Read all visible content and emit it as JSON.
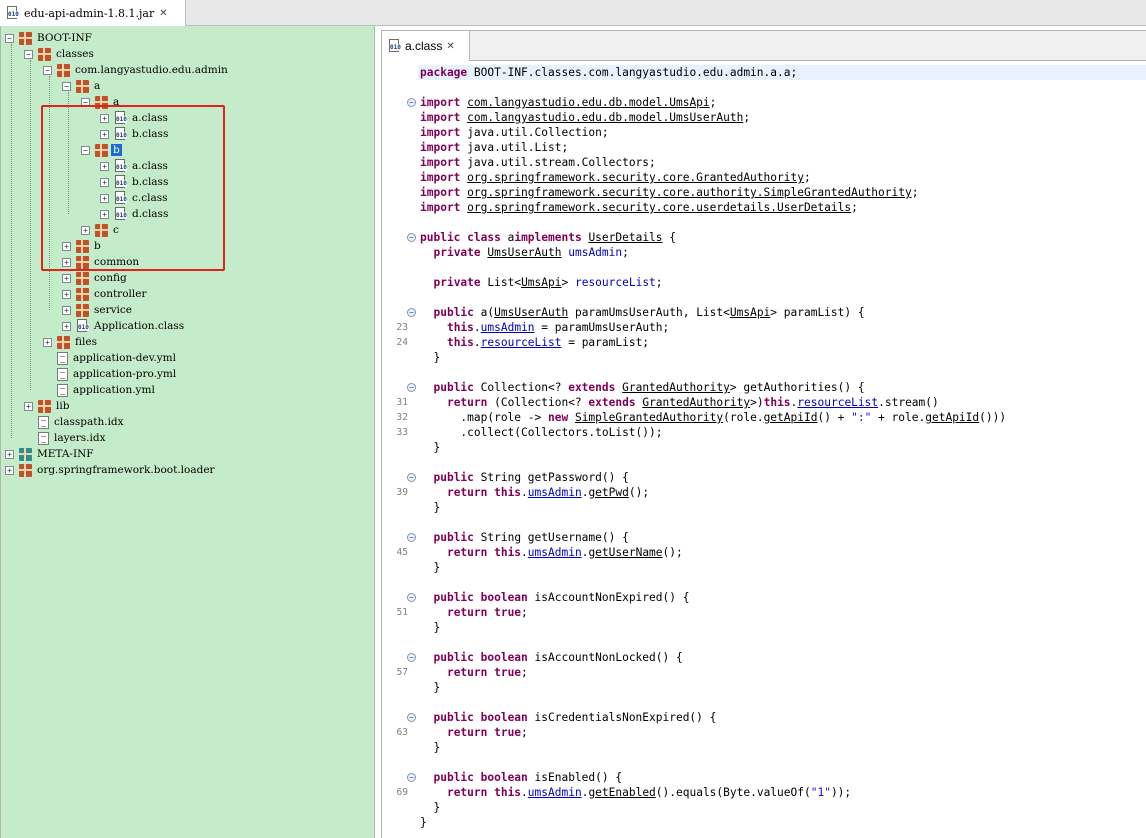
{
  "window": {
    "tab_title": "edu-api-admin-1.8.1.jar"
  },
  "tree": {
    "nodes": [
      {
        "label": "BOOT-INF",
        "icon": "package-icon",
        "expander": "minus"
      },
      {
        "label": "classes",
        "icon": "package-icon",
        "expander": "minus"
      },
      {
        "label": "com.langyastudio.edu.admin",
        "icon": "package-icon",
        "expander": "minus"
      },
      {
        "label": "a",
        "icon": "package-icon",
        "expander": "minus"
      },
      {
        "label": "a",
        "icon": "package-icon",
        "expander": "minus"
      },
      {
        "label": "a.class",
        "icon": "class-file-icon",
        "expander": "plus"
      },
      {
        "label": "b.class",
        "icon": "class-file-icon",
        "expander": "plus"
      },
      {
        "label": "b",
        "icon": "package-icon",
        "expander": "minus",
        "selected": true
      },
      {
        "label": "a.class",
        "icon": "class-file-icon",
        "expander": "plus"
      },
      {
        "label": "b.class",
        "icon": "class-file-icon",
        "expander": "plus"
      },
      {
        "label": "c.class",
        "icon": "class-file-icon",
        "expander": "plus"
      },
      {
        "label": "d.class",
        "icon": "class-file-icon",
        "expander": "plus"
      },
      {
        "label": "c",
        "icon": "package-icon",
        "expander": "plus"
      },
      {
        "label": "b",
        "icon": "package-icon",
        "expander": "plus"
      },
      {
        "label": "common",
        "icon": "package-icon",
        "expander": "plus"
      },
      {
        "label": "config",
        "icon": "package-icon",
        "expander": "plus"
      },
      {
        "label": "controller",
        "icon": "package-icon",
        "expander": "plus"
      },
      {
        "label": "service",
        "icon": "package-icon",
        "expander": "plus"
      },
      {
        "label": "Application.class",
        "icon": "class-file-icon",
        "expander": "plus"
      },
      {
        "label": "files",
        "icon": "package-icon",
        "expander": "plus"
      },
      {
        "label": "application-dev.yml",
        "icon": "text-file-icon",
        "expander": "none"
      },
      {
        "label": "application-pro.yml",
        "icon": "text-file-icon",
        "expander": "none"
      },
      {
        "label": "application.yml",
        "icon": "text-file-icon",
        "expander": "none"
      },
      {
        "label": "lib",
        "icon": "package-icon",
        "expander": "plus"
      },
      {
        "label": "classpath.idx",
        "icon": "text-file-icon",
        "expander": "none"
      },
      {
        "label": "layers.idx",
        "icon": "text-file-icon",
        "expander": "none"
      },
      {
        "label": "META-INF",
        "icon": "meta-package-icon",
        "expander": "plus"
      },
      {
        "label": "org.springframework.boot.loader",
        "icon": "package-icon",
        "expander": "plus"
      }
    ]
  },
  "editor": {
    "tab_label": "a.class",
    "lines": [
      {
        "num": "",
        "fold": "",
        "hl": true,
        "segs": [
          [
            "kw",
            "package"
          ],
          [
            "",
            "BOOT-INF.classes.com.langyastudio.edu.admin.a.a;"
          ]
        ]
      },
      {
        "num": "",
        "fold": "",
        "segs": []
      },
      {
        "num": "",
        "fold": "−",
        "segs": [
          [
            "kw",
            "import"
          ],
          [
            "u",
            "com.langyastudio.edu.db.model.UmsApi"
          ],
          [
            "",
            ";"
          ]
        ]
      },
      {
        "num": "",
        "fold": "",
        "segs": [
          [
            "kw",
            "import"
          ],
          [
            "u",
            "com.langyastudio.edu.db.model.UmsUserAuth"
          ],
          [
            "",
            ";"
          ]
        ]
      },
      {
        "num": "",
        "fold": "",
        "segs": [
          [
            "kw",
            "import"
          ],
          [
            "",
            "java.util.Collection;"
          ]
        ]
      },
      {
        "num": "",
        "fold": "",
        "segs": [
          [
            "kw",
            "import"
          ],
          [
            "",
            "java.util.List;"
          ]
        ]
      },
      {
        "num": "",
        "fold": "",
        "segs": [
          [
            "kw",
            "import"
          ],
          [
            "",
            "java.util.stream.Collectors;"
          ]
        ]
      },
      {
        "num": "",
        "fold": "",
        "segs": [
          [
            "kw",
            "import"
          ],
          [
            "u",
            "org.springframework.security.core.GrantedAuthority"
          ],
          [
            "",
            ";"
          ]
        ]
      },
      {
        "num": "",
        "fold": "",
        "segs": [
          [
            "kw",
            "import"
          ],
          [
            "u",
            "org.springframework.security.core.authority.SimpleGrantedAuthority"
          ],
          [
            "",
            ";"
          ]
        ]
      },
      {
        "num": "",
        "fold": "",
        "segs": [
          [
            "kw",
            "import"
          ],
          [
            "u",
            "org.springframework.security.core.userdetails.UserDetails"
          ],
          [
            "",
            ";"
          ]
        ]
      },
      {
        "num": "",
        "fold": "",
        "segs": []
      },
      {
        "num": "",
        "fold": "−",
        "segs": [
          [
            "kw",
            "public class"
          ],
          [
            "",
            "a"
          ],
          [
            "kw",
            "implements"
          ],
          [
            "u",
            "UserDetails"
          ],
          [
            "",
            " {"
          ]
        ]
      },
      {
        "num": "",
        "fold": "",
        "segs": [
          [
            "",
            "  "
          ],
          [
            "kw",
            "private"
          ],
          [
            "u",
            "UmsUserAuth"
          ],
          [
            "",
            " "
          ],
          [
            "fld",
            "umsAdmin"
          ],
          [
            "",
            ";"
          ]
        ]
      },
      {
        "num": "",
        "fold": "",
        "segs": []
      },
      {
        "num": "",
        "fold": "",
        "segs": [
          [
            "",
            "  "
          ],
          [
            "kw",
            "private"
          ],
          [
            "",
            " List<"
          ],
          [
            "u",
            "UmsApi"
          ],
          [
            "",
            "> "
          ],
          [
            "fld",
            "resourceList"
          ],
          [
            "",
            ";"
          ]
        ]
      },
      {
        "num": "",
        "fold": "",
        "segs": []
      },
      {
        "num": "",
        "fold": "−",
        "segs": [
          [
            "",
            "  "
          ],
          [
            "kw",
            "public"
          ],
          [
            "",
            " a("
          ],
          [
            "u",
            "UmsUserAuth"
          ],
          [
            "",
            " paramUmsUserAuth, List<"
          ],
          [
            "u",
            "UmsApi"
          ],
          [
            "",
            "> paramList) {"
          ]
        ]
      },
      {
        "num": "23",
        "fold": "",
        "segs": [
          [
            "",
            "    "
          ],
          [
            "kw",
            "this"
          ],
          [
            "",
            "."
          ],
          [
            "fld u",
            "umsAdmin"
          ],
          [
            "",
            " = paramUmsUserAuth;"
          ]
        ]
      },
      {
        "num": "24",
        "fold": "",
        "segs": [
          [
            "",
            "    "
          ],
          [
            "kw",
            "this"
          ],
          [
            "",
            "."
          ],
          [
            "fld u",
            "resourceList"
          ],
          [
            "",
            " = paramList;"
          ]
        ]
      },
      {
        "num": "",
        "fold": "",
        "segs": [
          [
            "",
            "  }"
          ]
        ]
      },
      {
        "num": "",
        "fold": "",
        "segs": []
      },
      {
        "num": "",
        "fold": "−",
        "segs": [
          [
            "",
            "  "
          ],
          [
            "kw",
            "public"
          ],
          [
            "",
            " Collection<? "
          ],
          [
            "kw",
            "extends"
          ],
          [
            "u",
            "GrantedAuthority"
          ],
          [
            "",
            "> getAuthorities() {"
          ]
        ]
      },
      {
        "num": "31",
        "fold": "",
        "segs": [
          [
            "",
            "    "
          ],
          [
            "kw",
            "return"
          ],
          [
            "",
            " (Collection<? "
          ],
          [
            "kw",
            "extends"
          ],
          [
            "u",
            "GrantedAuthority"
          ],
          [
            "",
            ">)"
          ],
          [
            "kw",
            "this"
          ],
          [
            "",
            "."
          ],
          [
            "fld u",
            "resourceList"
          ],
          [
            "",
            ".stream()"
          ]
        ]
      },
      {
        "num": "32",
        "fold": "",
        "segs": [
          [
            "",
            "      .map(role -> "
          ],
          [
            "kw",
            "new"
          ],
          [
            "u",
            "SimpleGrantedAuthority"
          ],
          [
            "",
            "(role."
          ],
          [
            "u",
            "getApiId"
          ],
          [
            "",
            "() + "
          ],
          [
            "str",
            "\":\""
          ],
          [
            "",
            " + role."
          ],
          [
            "u",
            "getApiId"
          ],
          [
            "",
            "()))"
          ]
        ]
      },
      {
        "num": "33",
        "fold": "",
        "segs": [
          [
            "",
            "      .collect(Collectors.toList());"
          ]
        ]
      },
      {
        "num": "",
        "fold": "",
        "segs": [
          [
            "",
            "  }"
          ]
        ]
      },
      {
        "num": "",
        "fold": "",
        "segs": []
      },
      {
        "num": "",
        "fold": "−",
        "segs": [
          [
            "",
            "  "
          ],
          [
            "kw",
            "public"
          ],
          [
            "",
            " String getPassword() {"
          ]
        ]
      },
      {
        "num": "39",
        "fold": "",
        "segs": [
          [
            "",
            "    "
          ],
          [
            "kw",
            "return this"
          ],
          [
            "",
            "."
          ],
          [
            "fld u",
            "umsAdmin"
          ],
          [
            "",
            "."
          ],
          [
            "u",
            "getPwd"
          ],
          [
            "",
            "();"
          ]
        ]
      },
      {
        "num": "",
        "fold": "",
        "segs": [
          [
            "",
            "  }"
          ]
        ]
      },
      {
        "num": "",
        "fold": "",
        "segs": []
      },
      {
        "num": "",
        "fold": "−",
        "segs": [
          [
            "",
            "  "
          ],
          [
            "kw",
            "public"
          ],
          [
            "",
            " String getUsername() {"
          ]
        ]
      },
      {
        "num": "45",
        "fold": "",
        "segs": [
          [
            "",
            "    "
          ],
          [
            "kw",
            "return this"
          ],
          [
            "",
            "."
          ],
          [
            "fld u",
            "umsAdmin"
          ],
          [
            "",
            "."
          ],
          [
            "u",
            "getUserName"
          ],
          [
            "",
            "();"
          ]
        ]
      },
      {
        "num": "",
        "fold": "",
        "segs": [
          [
            "",
            "  }"
          ]
        ]
      },
      {
        "num": "",
        "fold": "",
        "segs": []
      },
      {
        "num": "",
        "fold": "−",
        "segs": [
          [
            "",
            "  "
          ],
          [
            "kw",
            "public boolean"
          ],
          [
            "",
            " isAccountNonExpired() {"
          ]
        ]
      },
      {
        "num": "51",
        "fold": "",
        "segs": [
          [
            "",
            "    "
          ],
          [
            "kw",
            "return true"
          ],
          [
            "",
            ";"
          ]
        ]
      },
      {
        "num": "",
        "fold": "",
        "segs": [
          [
            "",
            "  }"
          ]
        ]
      },
      {
        "num": "",
        "fold": "",
        "segs": []
      },
      {
        "num": "",
        "fold": "−",
        "segs": [
          [
            "",
            "  "
          ],
          [
            "kw",
            "public boolean"
          ],
          [
            "",
            " isAccountNonLocked() {"
          ]
        ]
      },
      {
        "num": "57",
        "fold": "",
        "segs": [
          [
            "",
            "    "
          ],
          [
            "kw",
            "return true"
          ],
          [
            "",
            ";"
          ]
        ]
      },
      {
        "num": "",
        "fold": "",
        "segs": [
          [
            "",
            "  }"
          ]
        ]
      },
      {
        "num": "",
        "fold": "",
        "segs": []
      },
      {
        "num": "",
        "fold": "−",
        "segs": [
          [
            "",
            "  "
          ],
          [
            "kw",
            "public boolean"
          ],
          [
            "",
            " isCredentialsNonExpired() {"
          ]
        ]
      },
      {
        "num": "63",
        "fold": "",
        "segs": [
          [
            "",
            "    "
          ],
          [
            "kw",
            "return true"
          ],
          [
            "",
            ";"
          ]
        ]
      },
      {
        "num": "",
        "fold": "",
        "segs": [
          [
            "",
            "  }"
          ]
        ]
      },
      {
        "num": "",
        "fold": "",
        "segs": []
      },
      {
        "num": "",
        "fold": "−",
        "segs": [
          [
            "",
            "  "
          ],
          [
            "kw",
            "public boolean"
          ],
          [
            "",
            " isEnabled() {"
          ]
        ]
      },
      {
        "num": "69",
        "fold": "",
        "segs": [
          [
            "",
            "    "
          ],
          [
            "kw",
            "return this"
          ],
          [
            "",
            "."
          ],
          [
            "fld u",
            "umsAdmin"
          ],
          [
            "",
            "."
          ],
          [
            "u",
            "getEnabled"
          ],
          [
            "",
            "().equals(Byte.valueOf("
          ],
          [
            "str",
            "\"1\""
          ],
          [
            "",
            "));"
          ]
        ]
      },
      {
        "num": "",
        "fold": "",
        "segs": [
          [
            "",
            "  }"
          ]
        ]
      },
      {
        "num": "",
        "fold": "",
        "segs": [
          [
            "",
            "}"
          ]
        ]
      }
    ]
  }
}
